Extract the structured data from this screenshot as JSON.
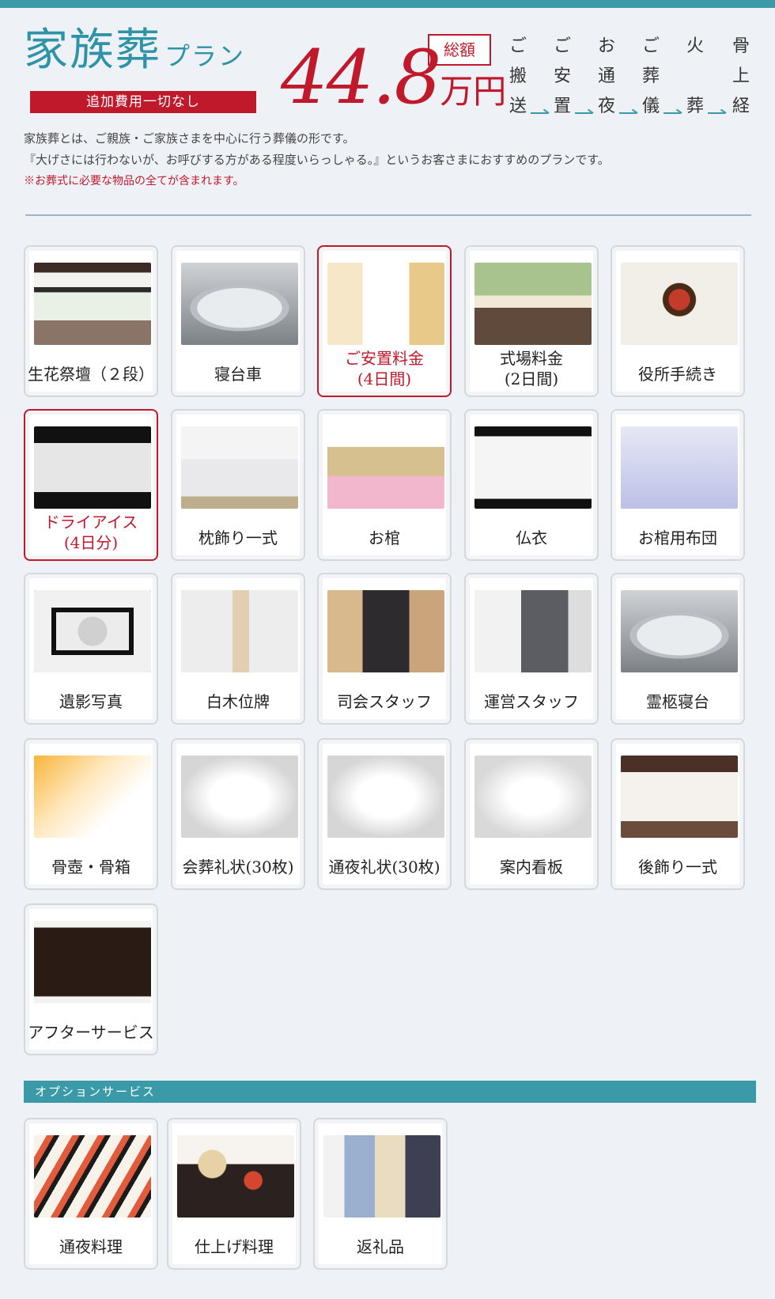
{
  "header": {
    "plan_title": "家族葬",
    "plan_suffix": "プラン",
    "no_extra": "追加費用一切なし",
    "total_label": "総額",
    "price_number": "44.8",
    "price_unit": "万円"
  },
  "flow": [
    [
      "ご",
      "搬",
      "送"
    ],
    [
      "ご",
      "安",
      "置"
    ],
    [
      "お",
      "通",
      "夜"
    ],
    [
      "ご",
      "葬",
      "儀"
    ],
    [
      "火",
      "",
      "葬"
    ],
    [
      "骨",
      "上",
      "経"
    ]
  ],
  "description": {
    "line1": "家族葬とは、ご親族・ご家族さまを中心に行う葬儀の形です。",
    "line2": "『大げさには行わないが、お呼びする方がある程度いらっしゃる。』というお客さまにおすすめのプランです。",
    "note": "※お葬式に必要な物品の全てが含まれます。"
  },
  "items": [
    {
      "label": "生花祭壇（２段）",
      "photo": "altar",
      "highlight": false
    },
    {
      "label": "寝台車",
      "photo": "car",
      "highlight": false
    },
    {
      "label": "ご安置料金\n(4日間)",
      "photo": "room",
      "highlight": true
    },
    {
      "label": "式場料金\n(2日間)",
      "photo": "hall",
      "highlight": false
    },
    {
      "label": "役所手続き",
      "photo": "stamp",
      "highlight": false
    },
    {
      "label": "ドライアイス\n(4日分)",
      "photo": "ice",
      "highlight": true
    },
    {
      "label": "枕飾り一式",
      "photo": "pillow",
      "highlight": false
    },
    {
      "label": "お棺",
      "photo": "coffin",
      "highlight": false
    },
    {
      "label": "仏衣",
      "photo": "cloth",
      "highlight": false
    },
    {
      "label": "お棺用布団",
      "photo": "futon",
      "highlight": false
    },
    {
      "label": "遺影写真",
      "photo": "frame",
      "highlight": false
    },
    {
      "label": "白木位牌",
      "photo": "tablet",
      "highlight": false
    },
    {
      "label": "司会スタッフ",
      "photo": "mc",
      "highlight": false
    },
    {
      "label": "運営スタッフ",
      "photo": "staff",
      "highlight": false
    },
    {
      "label": "霊柩寝台",
      "photo": "car",
      "highlight": false
    },
    {
      "label": "骨壺・骨箱",
      "photo": "urn",
      "highlight": false
    },
    {
      "label": "会葬礼状(30枚)",
      "photo": "letter",
      "highlight": false
    },
    {
      "label": "通夜礼状(30枚)",
      "photo": "letter",
      "highlight": false
    },
    {
      "label": "案内看板",
      "photo": "sign",
      "highlight": false
    },
    {
      "label": "後飾り一式",
      "photo": "after",
      "highlight": false
    },
    {
      "label": "アフターサービス",
      "photo": "butsudan",
      "highlight": false
    }
  ],
  "options": {
    "heading": "オプションサービス",
    "items": [
      {
        "label": "通夜料理",
        "photo": "sushi"
      },
      {
        "label": "仕上げ料理",
        "photo": "food"
      },
      {
        "label": "返礼品",
        "photo": "towel"
      }
    ]
  },
  "colors": {
    "accent": "#3a9aa8",
    "red": "#c0192c",
    "background": "#eef2f6"
  }
}
